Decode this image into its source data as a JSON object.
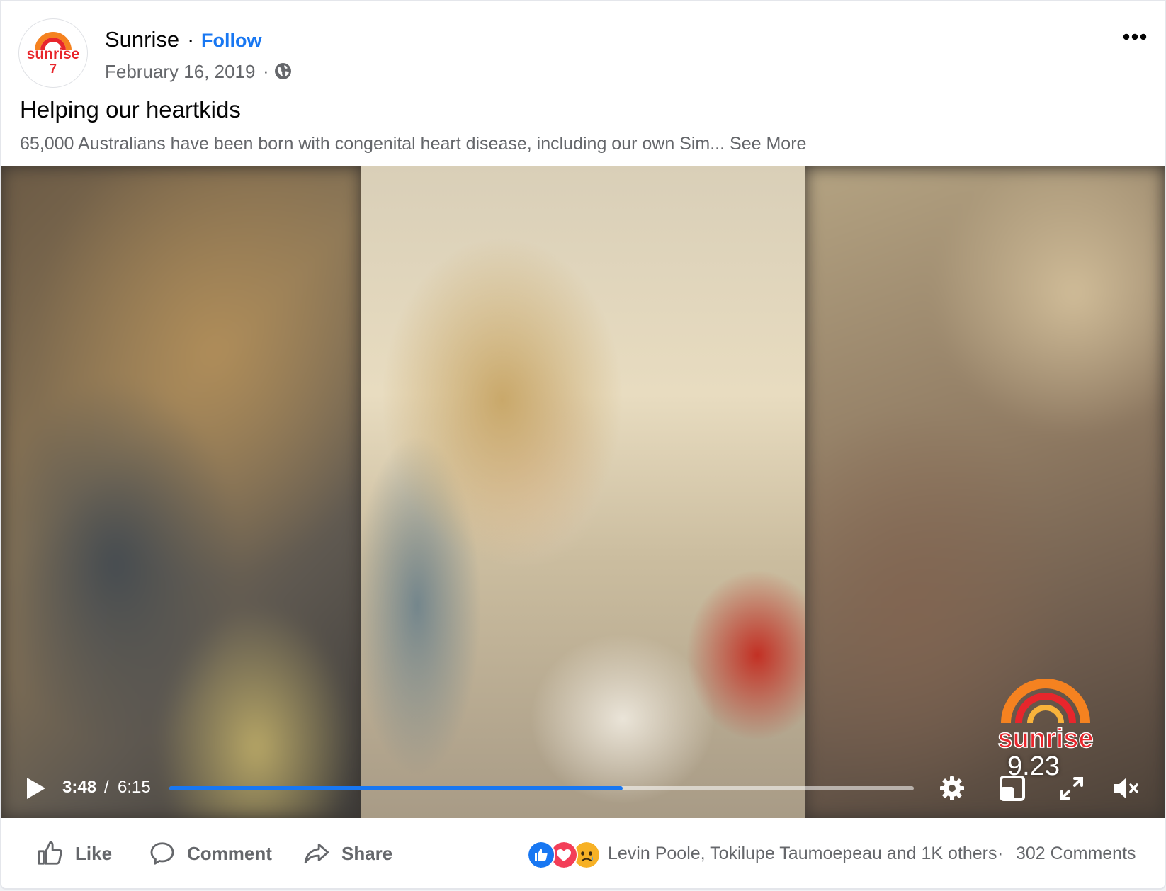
{
  "post": {
    "page_name": "Sunrise",
    "follow_label": "Follow",
    "date": "February 16, 2019",
    "separator": "·",
    "privacy_icon": "globe-icon",
    "title": "Helping our heartkids",
    "excerpt": "65,000 Australians have been born with congenital heart disease, including our own Sim...",
    "see_more_label": "See More"
  },
  "logo": {
    "text": "sunrise",
    "channel_mark": "7"
  },
  "video": {
    "current_time": "3:48",
    "separator": "/",
    "total_time": "6:15",
    "progress_fraction": 0.6085,
    "watermark_text": "sunrise",
    "watermark_time": "9.23",
    "icons": [
      "play-icon",
      "settings-icon",
      "picture-in-picture-icon",
      "fullscreen-icon",
      "mute-icon"
    ]
  },
  "actions": {
    "like_label": "Like",
    "comment_label": "Comment",
    "share_label": "Share"
  },
  "reactions": {
    "types": [
      "like",
      "love",
      "sad"
    ],
    "summary": "Levin Poole, Tokilupe Taumoepeau and 1K others",
    "separator": "·",
    "comment_count": "302 Comments"
  },
  "colors": {
    "accent": "#1877f2",
    "text": "#050505",
    "secondary_text": "#65676b",
    "love": "#f33e58",
    "sad": "#f7b125",
    "brand_red": "#e8262c",
    "brand_orange": "#f58220"
  }
}
